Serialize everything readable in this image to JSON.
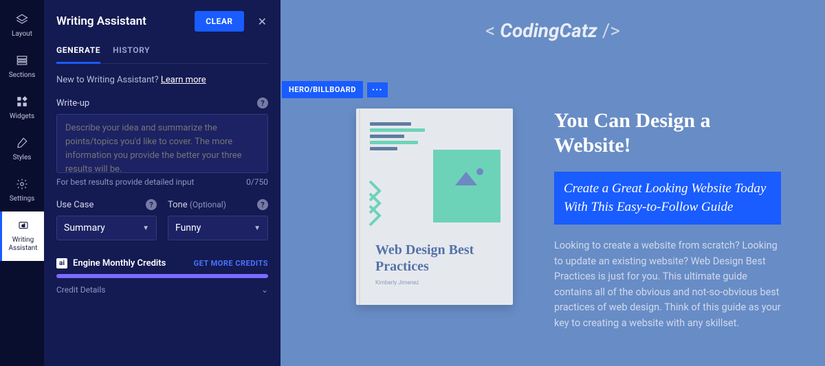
{
  "rail": {
    "items": [
      {
        "name": "layout",
        "label": "Layout"
      },
      {
        "name": "sections",
        "label": "Sections"
      },
      {
        "name": "widgets",
        "label": "Widgets"
      },
      {
        "name": "styles",
        "label": "Styles"
      },
      {
        "name": "settings",
        "label": "Settings"
      },
      {
        "name": "writing-assistant",
        "label": "Writing\nAssistant"
      }
    ]
  },
  "panel": {
    "title": "Writing Assistant",
    "clear_label": "CLEAR",
    "tabs": {
      "generate": "GENERATE",
      "history": "HISTORY"
    },
    "hint_prefix": "New to Writing Assistant? ",
    "hint_link": "Learn more",
    "writeup_label": "Write-up",
    "writeup_placeholder": "Describe your idea and summarize the points/topics you'd like to cover. The more information you provide the better your three results will be.",
    "counter_hint": "For best results provide detailed input",
    "counter_value": "0/750",
    "usecase_label": "Use Case",
    "usecase_value": "Summary",
    "tone_label": "Tone ",
    "tone_optional": "(Optional)",
    "tone_value": "Funny",
    "credits_label": "Engine Monthly Credits",
    "get_more": "GET MORE CREDITS",
    "credit_details": "Credit Details",
    "ai_badge": "ai"
  },
  "canvas": {
    "brand_pre": "< ",
    "brand_main": "CodingCatz",
    "brand_post": " />",
    "section_tag": "HERO/BILLBOARD",
    "section_more": "···",
    "book_title": "Web Design Best Practices",
    "book_author": "Kimberly Jimenez",
    "hero_h1": "You Can Design a Website!",
    "hero_sub": "Create a Great Looking Website Today With This Easy-to-Follow Guide",
    "hero_body": "Looking to create a website from scratch? Looking to update an existing website? Web Design Best Practices is just for you. This ultimate guide contains all of the obvious and not-so-obvious best practices of web design. Think of this guide as your key to creating a website with any skillset."
  }
}
